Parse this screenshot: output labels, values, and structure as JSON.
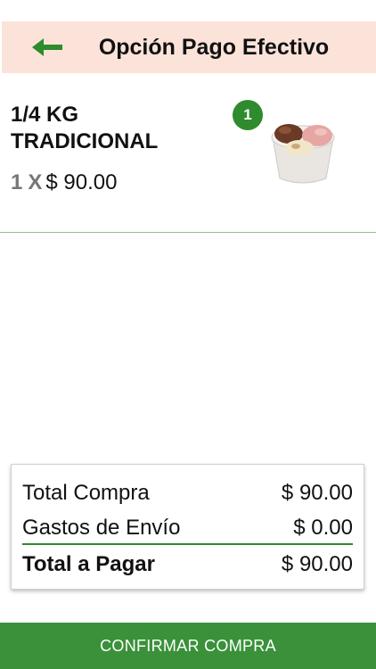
{
  "header": {
    "title": "Opción Pago Efectivo",
    "back_icon": "arrow-left-icon",
    "back_color": "#2e8b2e"
  },
  "cart_item": {
    "name": "1/4 KG TRADICIONAL",
    "quantity": "1",
    "multiplier": "X",
    "price": "$ 90.00",
    "badge_count": "1",
    "image": "ice-cream-cup-image"
  },
  "summary": {
    "total_compra_label": "Total Compra",
    "total_compra_value": "$ 90.00",
    "envio_label": "Gastos de Envío",
    "envio_value": "$ 0.00",
    "total_pagar_label": "Total a Pagar",
    "total_pagar_value": "$ 90.00"
  },
  "confirm_button": {
    "label": "CONFIRMAR COMPRA",
    "color": "#3a913a"
  }
}
